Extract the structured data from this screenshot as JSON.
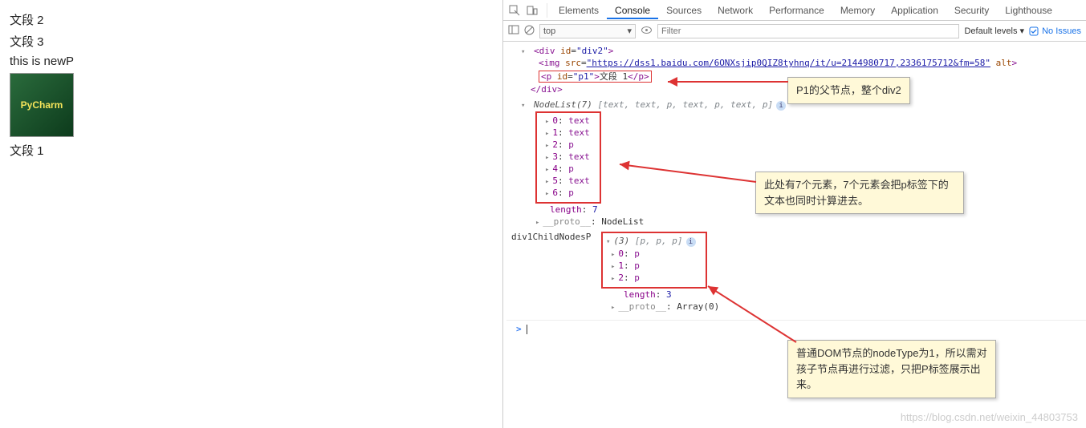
{
  "page": {
    "p2": "文段 2",
    "p3": "文段 3",
    "newp": "this is newP",
    "thumb_label": "PyCharm",
    "p1": "文段 1"
  },
  "devtools": {
    "tabs": [
      "Elements",
      "Console",
      "Sources",
      "Network",
      "Performance",
      "Memory",
      "Application",
      "Security",
      "Lighthouse"
    ],
    "active_tab": "Console",
    "context": "top",
    "filter_placeholder": "Filter",
    "levels": "Default levels ▾",
    "issues": "No Issues"
  },
  "console": {
    "div_open": "<div id=\"div2\">",
    "img_prefix": "<img src=",
    "img_url": "\"https://dss1.baidu.com/6ONXsjip0QIZ8tyhnq/it/u=2144980717,2336175712&fm=58\"",
    "img_suffix": " alt>",
    "p_line": "<p id=\"p1\">文段 1</p>",
    "div_close": "</div>",
    "nodelist_label": "NodeList(7)",
    "nodelist_preview": " [text, text, p, text, p, text, p]",
    "nl_items": [
      "0: text",
      "1: text",
      "2: p",
      "3: text",
      "4: p",
      "5: text",
      "6: p"
    ],
    "nl_length": "length: 7",
    "nl_proto": "__proto__: NodeList",
    "child_label": "div1ChildNodesP",
    "arr_head": "(3) [p, p, p]",
    "arr_items": [
      "0: p",
      "1: p",
      "2: p"
    ],
    "arr_length": "length: 3",
    "arr_proto": "__proto__: Array(0)",
    "prompt": ">"
  },
  "notes": {
    "n1": "P1的父节点，整个div2",
    "n2": "此处有7个元素，7个元素会把p标签下的文本也同时计算进去。",
    "n3": "普通DOM节点的nodeType为1，所以需对孩子节点再进行过滤，只把P标签展示出来。"
  },
  "watermark": "https://blog.csdn.net/weixin_44803753"
}
